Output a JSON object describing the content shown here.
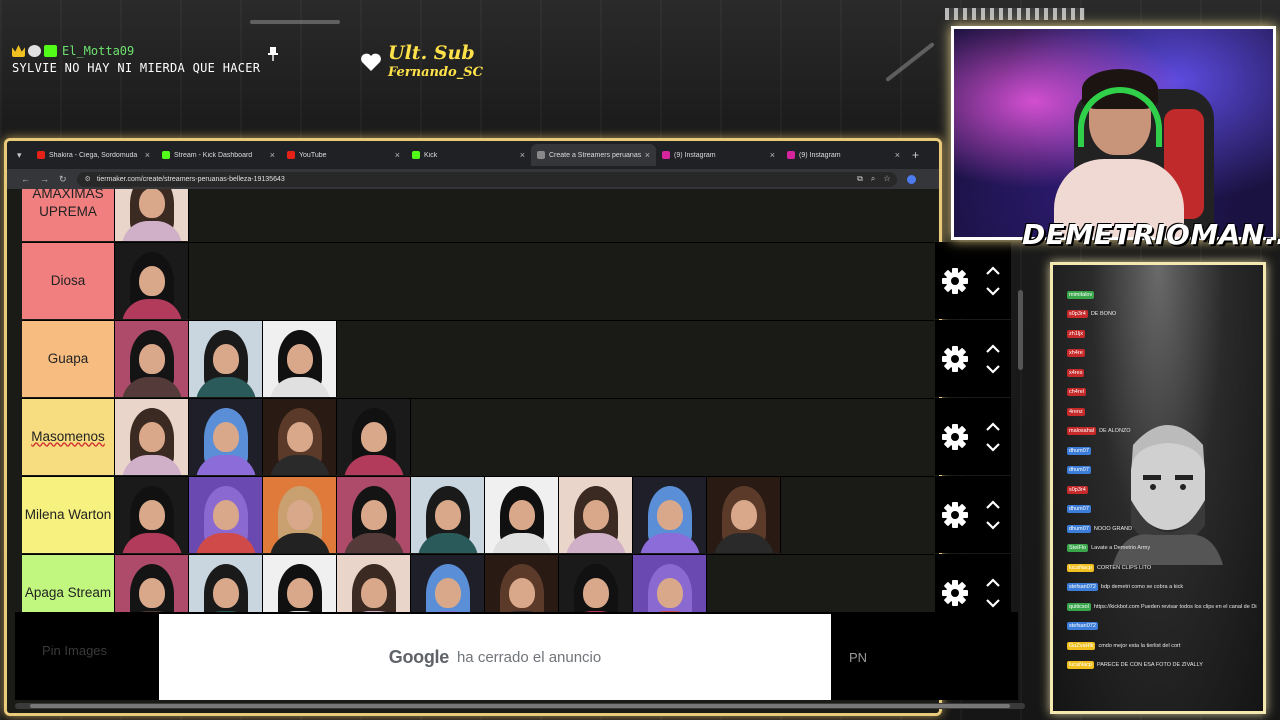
{
  "overlay": {
    "chat_user": "El_Motta09",
    "chat_message": "SYLVIE NO HAY NI MIERDA QUE HACER",
    "last_sub_title": "Ult. Sub",
    "last_sub_name": "Fernando_SC",
    "streamer_name": "DEMETRIOMAN..."
  },
  "browser": {
    "tabs": [
      {
        "label": "Shakira - Ciega, Sordomuda",
        "color": "#e62117",
        "active": false
      },
      {
        "label": "Stream - Kick Dashboard",
        "color": "#53fc18",
        "active": false
      },
      {
        "label": "YouTube",
        "color": "#e62117",
        "active": false
      },
      {
        "label": "Kick",
        "color": "#53fc18",
        "active": false
      },
      {
        "label": "Create a Streamers peruanas b...",
        "color": "#888888",
        "active": true
      },
      {
        "label": "(9) Instagram",
        "color": "#d6249f",
        "active": false
      },
      {
        "label": "(9) Instagram",
        "color": "#d6249f",
        "active": false
      }
    ],
    "url": "tiermaker.com/create/streamers-peruanas-belleza-19135643"
  },
  "tiers": [
    {
      "label": "AMAXIMAS UPREMA",
      "color": "#f27f7f",
      "count": 1
    },
    {
      "label": "Diosa",
      "color": "#f27f7f",
      "count": 1
    },
    {
      "label": "Guapa",
      "color": "#f7bd80",
      "count": 3
    },
    {
      "label": "Masomenos",
      "color": "#f7dc80",
      "count": 4
    },
    {
      "label": "Milena Warton",
      "color": "#f7f280",
      "count": 9
    },
    {
      "label": "Apaga Stream",
      "color": "#c2f77f",
      "count": 8
    }
  ],
  "ad": {
    "pin_images": "Pin Images",
    "google": "Google",
    "closed_text": "ha cerrado el anuncio",
    "pn": "PN"
  },
  "chat": [
    {
      "name": "mimitalov",
      "color": "#3aa64b",
      "msg": ""
    },
    {
      "name": "s0p3r4",
      "color": "#c62a2a",
      "msg": "DE BONO"
    },
    {
      "name": "zh1ljx",
      "color": "#c62a2a",
      "msg": ""
    },
    {
      "name": "xh4re",
      "color": "#c62a2a",
      "msg": ""
    },
    {
      "name": "x4res",
      "color": "#c62a2a",
      "msg": ""
    },
    {
      "name": "ch4rel",
      "color": "#c62a2a",
      "msg": ""
    },
    {
      "name": "4renz",
      "color": "#c62a2a",
      "msg": ""
    },
    {
      "name": "malosahal",
      "color": "#c62a2a",
      "msg": "DE ALONZO"
    },
    {
      "name": "dhum07",
      "color": "#3b7dd8",
      "msg": ""
    },
    {
      "name": "dhum07",
      "color": "#3b7dd8",
      "msg": ""
    },
    {
      "name": "s0p3r4",
      "color": "#c62a2a",
      "msg": ""
    },
    {
      "name": "dhum07",
      "color": "#3b7dd8",
      "msg": ""
    },
    {
      "name": "dhum07",
      "color": "#3b7dd8",
      "msg": "NOOO GRAND"
    },
    {
      "name": "StelFlo",
      "color": "#3aa64b",
      "msg": "Lavate a Demetrio Army"
    },
    {
      "name": "lucaNacp",
      "color": "#f0c020",
      "msg": "CORTEN CLIPS LITO"
    },
    {
      "name": "stefsan072",
      "color": "#3b7dd8",
      "msg": "bdp demetri como se cobra a kick"
    },
    {
      "name": "quiticsol",
      "color": "#3aa64b",
      "msg": "https://kickbot.com Pueden revisar todos los clips en el canal de Discord \"Clips\""
    },
    {
      "name": "stefsan072",
      "color": "#3b7dd8",
      "msg": ""
    },
    {
      "name": "GuZvaHlk",
      "color": "#f0c020",
      "msg": "cmdo mejor esta la tierlist del cort"
    },
    {
      "name": "lucaNacp",
      "color": "#f0c020",
      "msg": "PARECE DE CON ESA FOTO DE ZIVALLY"
    }
  ]
}
